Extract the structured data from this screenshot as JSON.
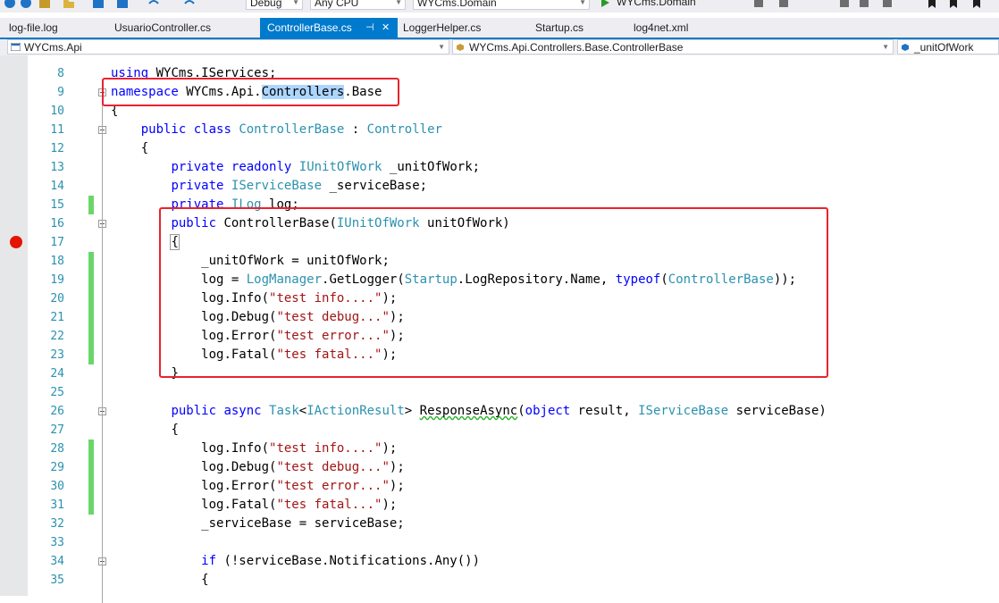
{
  "toolbar": {
    "config": "Debug",
    "platform": "Any CPU",
    "startup_project": "WYCms.Domain"
  },
  "tabs": [
    {
      "label": "log-file.log",
      "active": false
    },
    {
      "label": "UsuarioController.cs",
      "active": false
    },
    {
      "label": "ControllerBase.cs",
      "active": true
    },
    {
      "label": "LoggerHelper.cs",
      "active": false
    },
    {
      "label": "Startup.cs",
      "active": false
    },
    {
      "label": "log4net.xml",
      "active": false
    }
  ],
  "nav": {
    "project": "WYCms.Api",
    "type": "WYCms.Api.Controllers.Base.ControllerBase",
    "member": "_unitOfWork"
  },
  "lines": [
    {
      "n": "8",
      "text": "using WYCms.IServices;"
    },
    {
      "n": "9",
      "text": "namespace WYCms.Api.Controllers.Base"
    },
    {
      "n": "10",
      "text": "{"
    },
    {
      "n": "11",
      "text": "public class ControllerBase : Controller"
    },
    {
      "n": "12",
      "text": "{"
    },
    {
      "n": "13",
      "text": "private readonly IUnitOfWork _unitOfWork;"
    },
    {
      "n": "14",
      "text": "private IServiceBase _serviceBase;"
    },
    {
      "n": "15",
      "text": "private ILog log;"
    },
    {
      "n": "16",
      "text": "public ControllerBase(IUnitOfWork unitOfWork)"
    },
    {
      "n": "17",
      "text": "{"
    },
    {
      "n": "18",
      "text": "_unitOfWork = unitOfWork;"
    },
    {
      "n": "19",
      "text": "log = LogManager.GetLogger(Startup.LogRepository.Name, typeof(ControllerBase));"
    },
    {
      "n": "20",
      "text": "log.Info(\"test info....\");"
    },
    {
      "n": "21",
      "text": "log.Debug(\"test debug...\");"
    },
    {
      "n": "22",
      "text": "log.Error(\"test error...\");"
    },
    {
      "n": "23",
      "text": "log.Fatal(\"tes fatal...\");"
    },
    {
      "n": "24",
      "text": "}"
    },
    {
      "n": "25",
      "text": ""
    },
    {
      "n": "26",
      "text": "public async Task<IActionResult> ResponseAsync(object result, IServiceBase serviceBase)"
    },
    {
      "n": "27",
      "text": "{"
    },
    {
      "n": "28",
      "text": "log.Info(\"test info....\");"
    },
    {
      "n": "29",
      "text": "log.Debug(\"test debug...\");"
    },
    {
      "n": "30",
      "text": "log.Error(\"test error...\");"
    },
    {
      "n": "31",
      "text": "log.Fatal(\"tes fatal...\");"
    },
    {
      "n": "32",
      "text": "_serviceBase = serviceBase;"
    },
    {
      "n": "33",
      "text": ""
    },
    {
      "n": "34",
      "text": "if (!serviceBase.Notifications.Any())"
    },
    {
      "n": "35",
      "text": "{"
    }
  ],
  "colors": {
    "keyword": "#0000ff",
    "type": "#2b91af",
    "string": "#a31515",
    "accent": "#007acc",
    "highlight_box": "#e8232f",
    "breakpoint": "#e51400",
    "change_marker": "#6ad66a"
  }
}
